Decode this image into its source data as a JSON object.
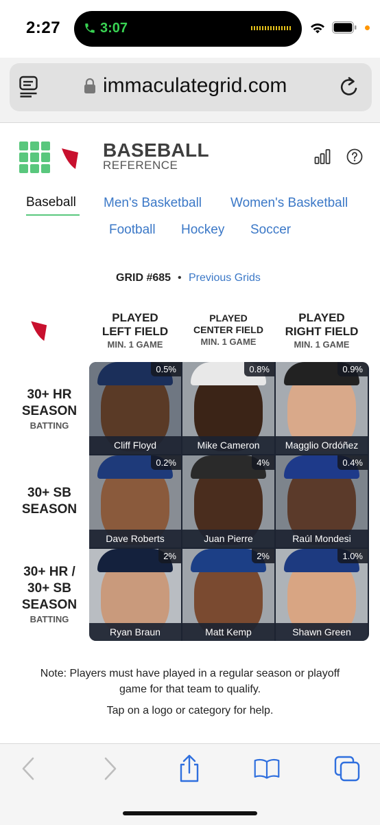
{
  "status_bar": {
    "time": "2:27",
    "call_timer": "3:07"
  },
  "browser": {
    "url": "immaculategrid.com"
  },
  "site": {
    "logo_line1": "BASEBALL",
    "logo_line2": "REFERENCE",
    "sports": [
      "Baseball",
      "Men's Basketball",
      "Women's Basketball",
      "Football",
      "Hockey",
      "Soccer"
    ],
    "active_sport": "Baseball",
    "grid_number": "GRID #685",
    "grid_separator": "•",
    "previous_grids_label": "Previous Grids"
  },
  "columns": [
    {
      "line1": "PLAYED",
      "line2": "LEFT FIELD",
      "min": "MIN. 1 GAME"
    },
    {
      "line1": "PLAYED",
      "line2": "CENTER FIELD",
      "min": "MIN. 1 GAME"
    },
    {
      "line1": "PLAYED",
      "line2": "RIGHT FIELD",
      "min": "MIN. 1 GAME"
    }
  ],
  "rows": [
    {
      "line1": "30+ HR",
      "line2": "SEASON",
      "line3": "",
      "sub": "BATTING"
    },
    {
      "line1": "30+ SB",
      "line2": "SEASON",
      "line3": "",
      "sub": ""
    },
    {
      "line1": "30+ HR /",
      "line2": "30+ SB",
      "line3": "SEASON",
      "sub": "BATTING"
    }
  ],
  "cells": [
    [
      {
        "name": "Cliff Floyd",
        "pct": "0.5%"
      },
      {
        "name": "Mike Cameron",
        "pct": "0.8%"
      },
      {
        "name": "Magglio Ordóñez",
        "pct": "0.9%"
      }
    ],
    [
      {
        "name": "Dave Roberts",
        "pct": "0.2%"
      },
      {
        "name": "Juan Pierre",
        "pct": "4%"
      },
      {
        "name": "Raúl Mondesi",
        "pct": "0.4%"
      }
    ],
    [
      {
        "name": "Ryan Braun",
        "pct": "2%"
      },
      {
        "name": "Matt Kemp",
        "pct": "2%"
      },
      {
        "name": "Shawn Green",
        "pct": "1.0%"
      }
    ]
  ],
  "notes": {
    "qualify_line1": "Note: Players must have played in a regular season or playoff",
    "qualify_line2": "game for that team to qualify.",
    "tap": "Tap on a logo or category for help."
  },
  "colors": {
    "accent_green": "#59c77d",
    "link_blue": "#3b78c7",
    "board_navy": "#1c2331",
    "bbref_red": "#c8102e"
  },
  "icons": [
    "reader-icon",
    "lock-icon",
    "reload-icon",
    "grid-logo-icon",
    "stats-icon",
    "help-icon",
    "back-icon",
    "forward-icon",
    "share-icon",
    "bookmarks-icon",
    "tabs-icon"
  ]
}
